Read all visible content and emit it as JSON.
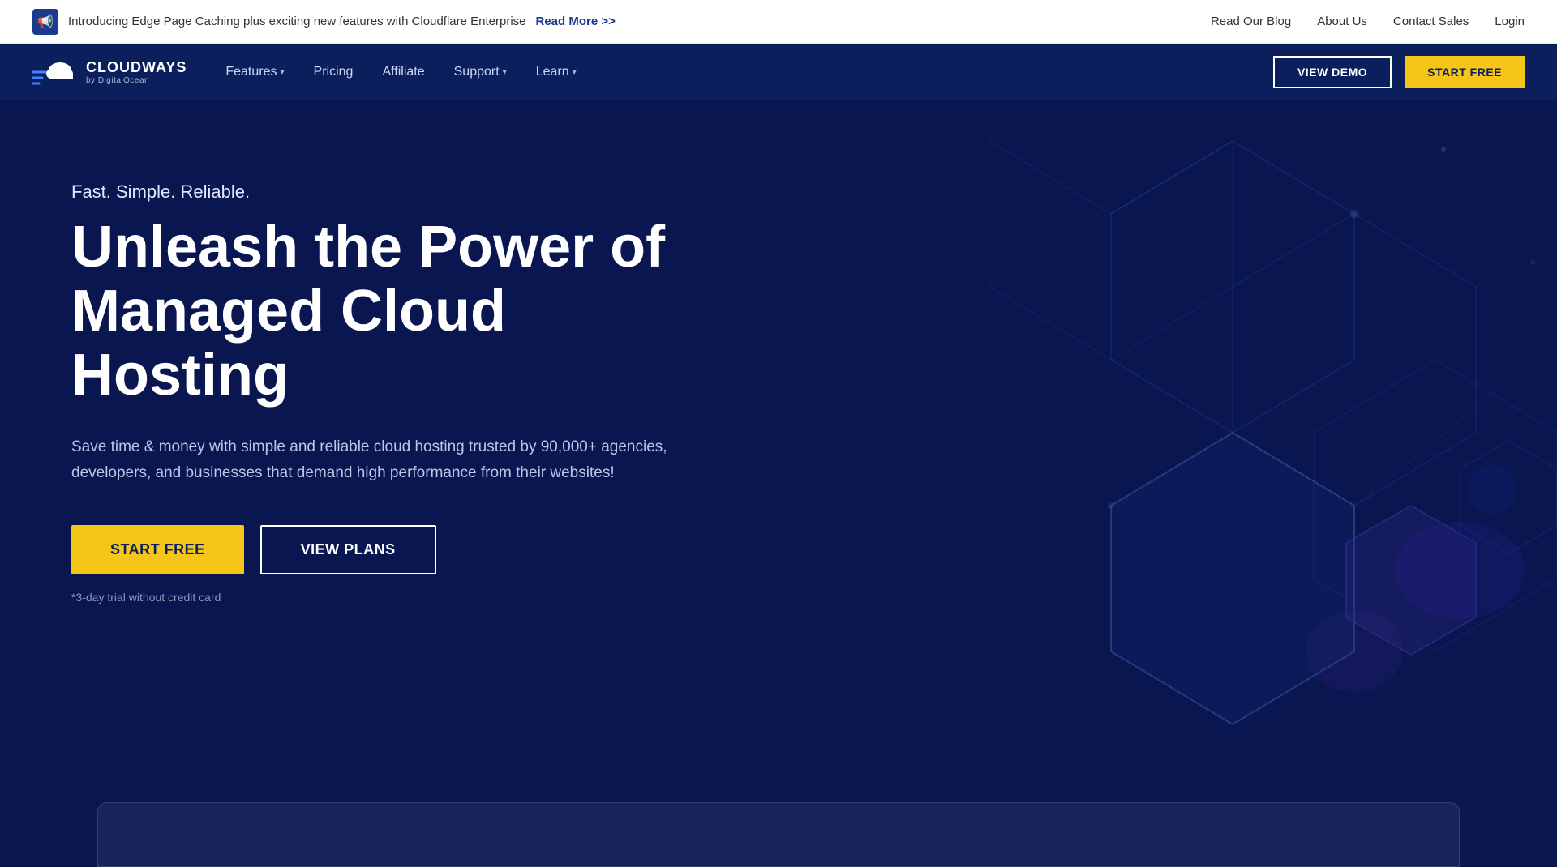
{
  "announcement": {
    "icon": "📢",
    "text": "Introducing Edge Page Caching plus exciting new features with Cloudflare Enterprise",
    "read_more": "Read More >>",
    "right_links": [
      {
        "label": "Read Our Blog",
        "key": "read-our-blog"
      },
      {
        "label": "About Us",
        "key": "about-us"
      },
      {
        "label": "Contact Sales",
        "key": "contact-sales"
      },
      {
        "label": "Login",
        "key": "login"
      }
    ]
  },
  "navbar": {
    "logo_main": "CLOUDWAYS",
    "logo_sub": "by DigitalOcean",
    "nav_items": [
      {
        "label": "Features",
        "has_dropdown": true
      },
      {
        "label": "Pricing",
        "has_dropdown": false
      },
      {
        "label": "Affiliate",
        "has_dropdown": false
      },
      {
        "label": "Support",
        "has_dropdown": true
      },
      {
        "label": "Learn",
        "has_dropdown": true
      }
    ],
    "view_demo_label": "VIEW DEMO",
    "start_free_label": "START FREE"
  },
  "hero": {
    "tagline": "Fast. Simple. Reliable.",
    "title": "Unleash the Power of Managed Cloud Hosting",
    "description": "Save time & money with simple and reliable cloud hosting trusted by 90,000+ agencies, developers, and businesses that demand high performance from their websites!",
    "start_free_label": "START FREE",
    "view_plans_label": "VIEW PLANS",
    "trial_note": "*3-day trial without credit card"
  },
  "colors": {
    "accent_yellow": "#f5c518",
    "navy_dark": "#0a1650",
    "navy_nav": "#0a1f5c"
  }
}
